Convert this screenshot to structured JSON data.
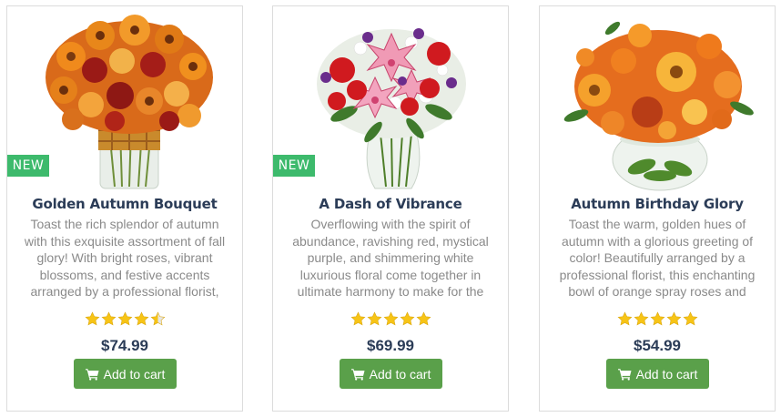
{
  "products": [
    {
      "name": "Golden Autumn Bouquet",
      "badge": "NEW",
      "description": "Toast the rich splendor of autumn with this exquisite assortment of fall glory! With bright roses, vibrant blossoms, and festive accents arranged by a professional florist,",
      "rating": 4.5,
      "price": "$74.99",
      "button_label": "Add to cart",
      "image": "flower-bouquet-orange-roses-gerberas"
    },
    {
      "name": "A Dash of Vibrance",
      "badge": "NEW",
      "description": "Overflowing with the spirit of abundance, ravishing red, mystical purple, and shimmering white luxurious floral come together in ultimate harmony to make for the",
      "rating": 5,
      "price": "$69.99",
      "button_label": "Add to cart",
      "image": "flower-bouquet-pink-lilies-red-roses"
    },
    {
      "name": "Autumn Birthday Glory",
      "badge": "",
      "description": "Toast the warm, golden hues of autumn with a glorious greeting of color! Beautifully arranged by a professional florist, this enchanting bowl of orange spray roses and",
      "rating": 5,
      "price": "$54.99",
      "button_label": "Add to cart",
      "image": "flower-bowl-orange-gerberas-roses"
    }
  ],
  "colors": {
    "badge": "#3dba6c",
    "button": "#5aa04a",
    "title": "#2b3c57",
    "star": "#f7c416"
  }
}
